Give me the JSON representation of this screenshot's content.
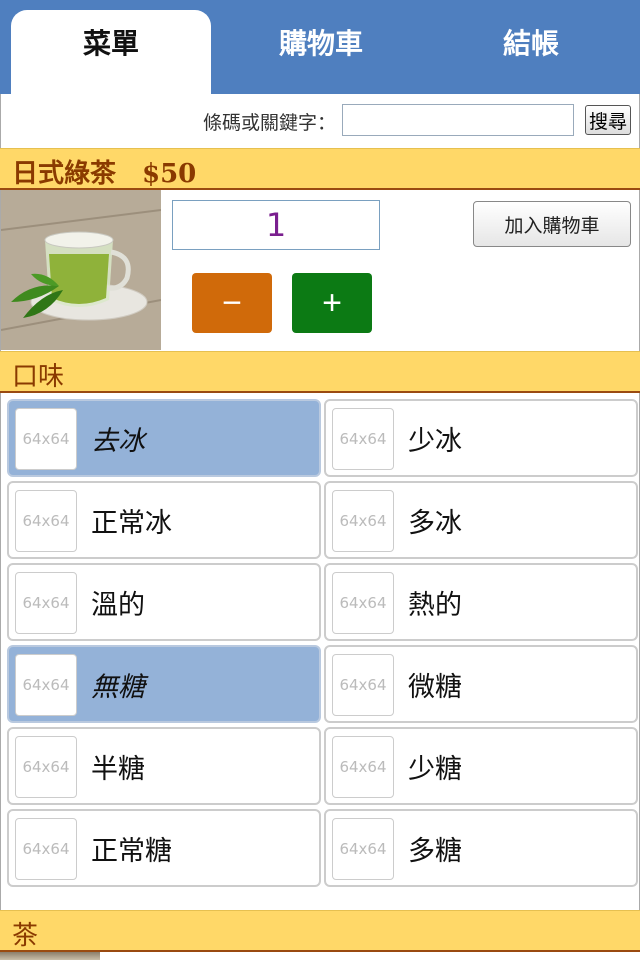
{
  "tabs": [
    {
      "label": "菜單",
      "active": true
    },
    {
      "label": "購物車",
      "active": false
    },
    {
      "label": "結帳",
      "active": false
    }
  ],
  "search": {
    "label": "條碼或關鍵字：",
    "value": "",
    "button": "搜尋"
  },
  "product": {
    "header": "日式綠茶　$50",
    "quantity": "1",
    "add_to_cart": "加入購物車",
    "minus": "−",
    "plus": "+"
  },
  "flavor": {
    "header": "口味",
    "placeholder": "64x64",
    "options": [
      {
        "label": "去冰",
        "selected": true
      },
      {
        "label": "少冰",
        "selected": false
      },
      {
        "label": "正常冰",
        "selected": false
      },
      {
        "label": "多冰",
        "selected": false
      },
      {
        "label": "溫的",
        "selected": false
      },
      {
        "label": "熱的",
        "selected": false
      },
      {
        "label": "無糖",
        "selected": true
      },
      {
        "label": "微糖",
        "selected": false
      },
      {
        "label": "半糖",
        "selected": false
      },
      {
        "label": "少糖",
        "selected": false
      },
      {
        "label": "正常糖",
        "selected": false
      },
      {
        "label": "多糖",
        "selected": false
      }
    ]
  },
  "tea_section": {
    "header": "茶"
  },
  "colors": {
    "tabbar": "#4f7fbf",
    "section_bar": "#ffd868",
    "section_text": "#8a3a00",
    "minus_button": "#d06a0a",
    "plus_button": "#0c7a14",
    "selected_option": "#94b2d8"
  }
}
